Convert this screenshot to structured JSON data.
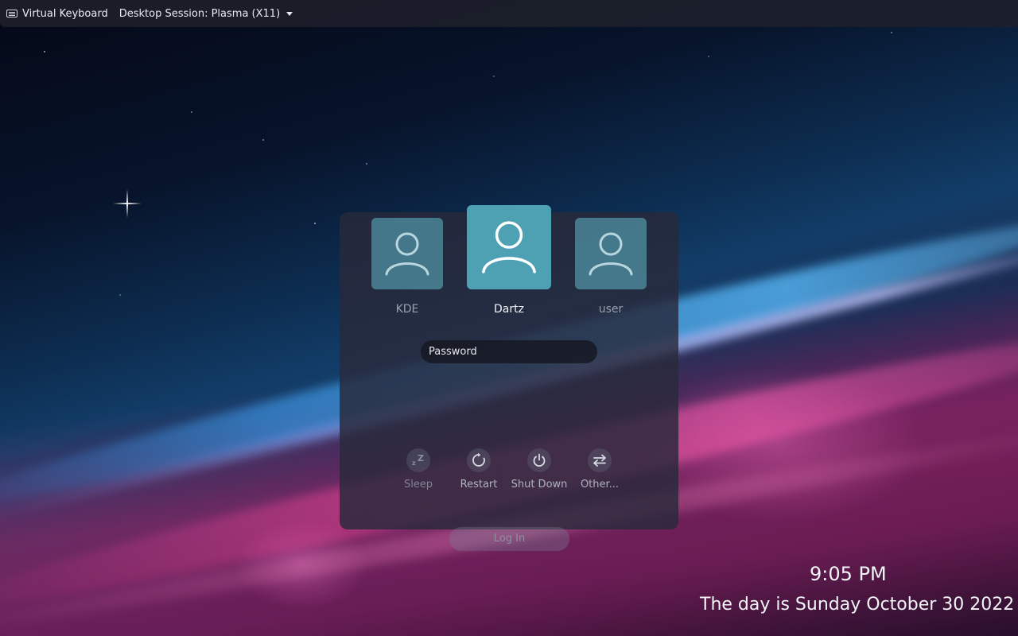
{
  "topbar": {
    "virtual_keyboard_label": "Virtual Keyboard",
    "session_label": "Desktop Session: Plasma (X11)"
  },
  "users": [
    {
      "name": "KDE",
      "selected": false
    },
    {
      "name": "Dartz",
      "selected": true
    },
    {
      "name": "user",
      "selected": false
    }
  ],
  "password": {
    "placeholder": "Password",
    "value": ""
  },
  "actions": [
    {
      "label": "Sleep",
      "icon": "sleep-icon",
      "enabled": false
    },
    {
      "label": "Restart",
      "icon": "restart-icon",
      "enabled": true
    },
    {
      "label": "Shut Down",
      "icon": "power-icon",
      "enabled": true
    },
    {
      "label": "Other...",
      "icon": "switch-user-icon",
      "enabled": true
    }
  ],
  "login": {
    "label": "Log In",
    "enabled": false
  },
  "clock": {
    "time": "9:05 PM",
    "date": "The day is Sunday October 30 2022"
  },
  "colors": {
    "avatar_accent": "#4da1b3"
  }
}
